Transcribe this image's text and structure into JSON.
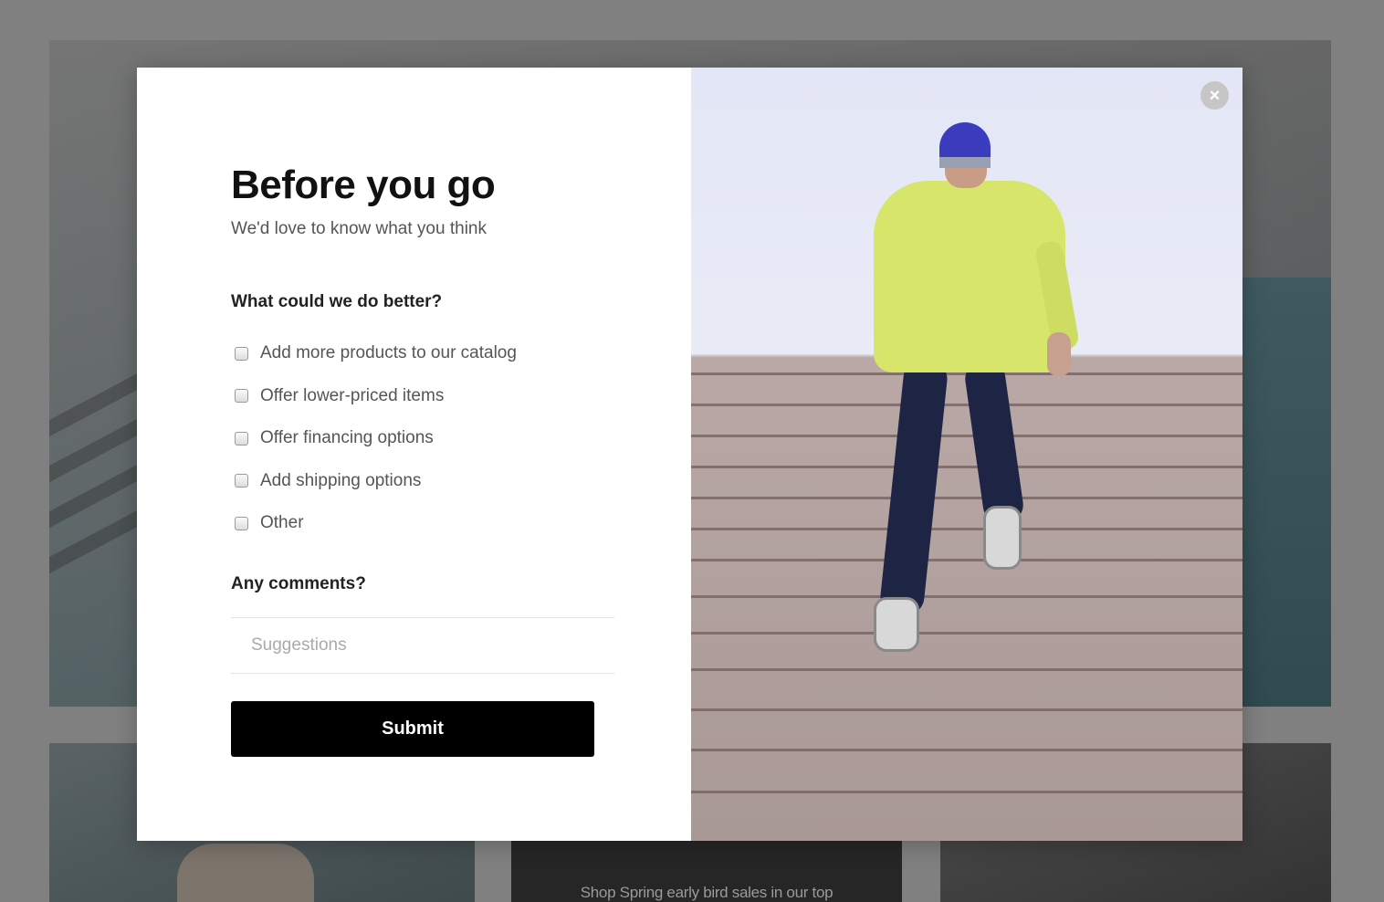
{
  "background": {
    "promo_text": "Shop Spring early bird sales in our top"
  },
  "modal": {
    "title": "Before you go",
    "subtitle": "We'd love to know what you think",
    "question_1": "What could we do better?",
    "options": [
      {
        "label": "Add more products to our catalog",
        "checked": false
      },
      {
        "label": "Offer lower-priced items",
        "checked": false
      },
      {
        "label": "Offer financing options",
        "checked": false
      },
      {
        "label": "Add shipping options",
        "checked": false
      },
      {
        "label": "Other",
        "checked": false
      }
    ],
    "question_2": "Any comments?",
    "comments": {
      "placeholder": "Suggestions",
      "value": ""
    },
    "submit_label": "Submit",
    "close_glyph": "×",
    "close_icon": "close-icon"
  },
  "colors": {
    "overlay": "#7a7a7a",
    "submit_bg": "#000000",
    "submit_text": "#ffffff",
    "close_bg": "#c6c6c6",
    "jacket": "#d7e66a",
    "hat": "#3c3cbf"
  }
}
